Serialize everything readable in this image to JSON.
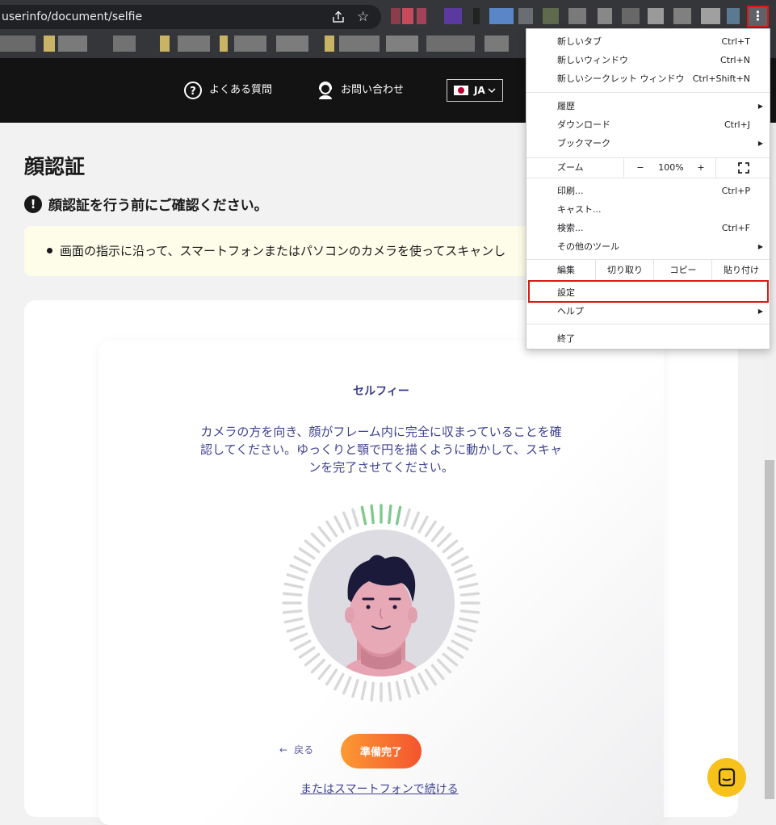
{
  "browser": {
    "url": "userinfo/document/selfie",
    "menu_dots": "⋮"
  },
  "site_nav": {
    "faq": "よくある質問",
    "contact": "お問い合わせ",
    "language": "JA"
  },
  "page": {
    "title": "顔認証",
    "notice": "顔認証を行う前にご確認ください。",
    "info_item": "画面の指示に沿って、スマートフォンまたはパソコンのカメラを使ってスキャンし",
    "selfie_title": "セルフィー",
    "instructions": "カメラの方を向き、顔がフレーム内に完全に収まっていることを確認してください。ゆっくりと顎で円を描くように動かして、スキャンを完了させてください。",
    "back_label": "戻る",
    "ready_label": "準備完了",
    "alt_link": "またはスマートフォンで続ける",
    "progress_fraction": 0.08
  },
  "menu": {
    "new_tab": {
      "label": "新しいタブ",
      "shortcut": "Ctrl+T"
    },
    "new_window": {
      "label": "新しいウィンドウ",
      "shortcut": "Ctrl+N"
    },
    "new_incognito": {
      "label": "新しいシークレット ウィンドウ",
      "shortcut": "Ctrl+Shift+N"
    },
    "history": {
      "label": "履歴"
    },
    "downloads": {
      "label": "ダウンロード",
      "shortcut": "Ctrl+J"
    },
    "bookmarks": {
      "label": "ブックマーク"
    },
    "zoom": {
      "label": "ズーム",
      "minus": "−",
      "value": "100%",
      "plus": "+"
    },
    "print": {
      "label": "印刷...",
      "shortcut": "Ctrl+P"
    },
    "cast": {
      "label": "キャスト..."
    },
    "find": {
      "label": "検索...",
      "shortcut": "Ctrl+F"
    },
    "more_tools": {
      "label": "その他のツール"
    },
    "edit": {
      "label": "編集",
      "cut": "切り取り",
      "copy": "コピー",
      "paste": "貼り付け"
    },
    "settings": {
      "label": "設定"
    },
    "help": {
      "label": "ヘルプ"
    },
    "exit": {
      "label": "終了"
    }
  },
  "colors": {
    "accent_red": "#e01616",
    "brand_navy": "#3e4290",
    "button_orange": "#f4542e",
    "progress_green": "#7fc98a"
  }
}
